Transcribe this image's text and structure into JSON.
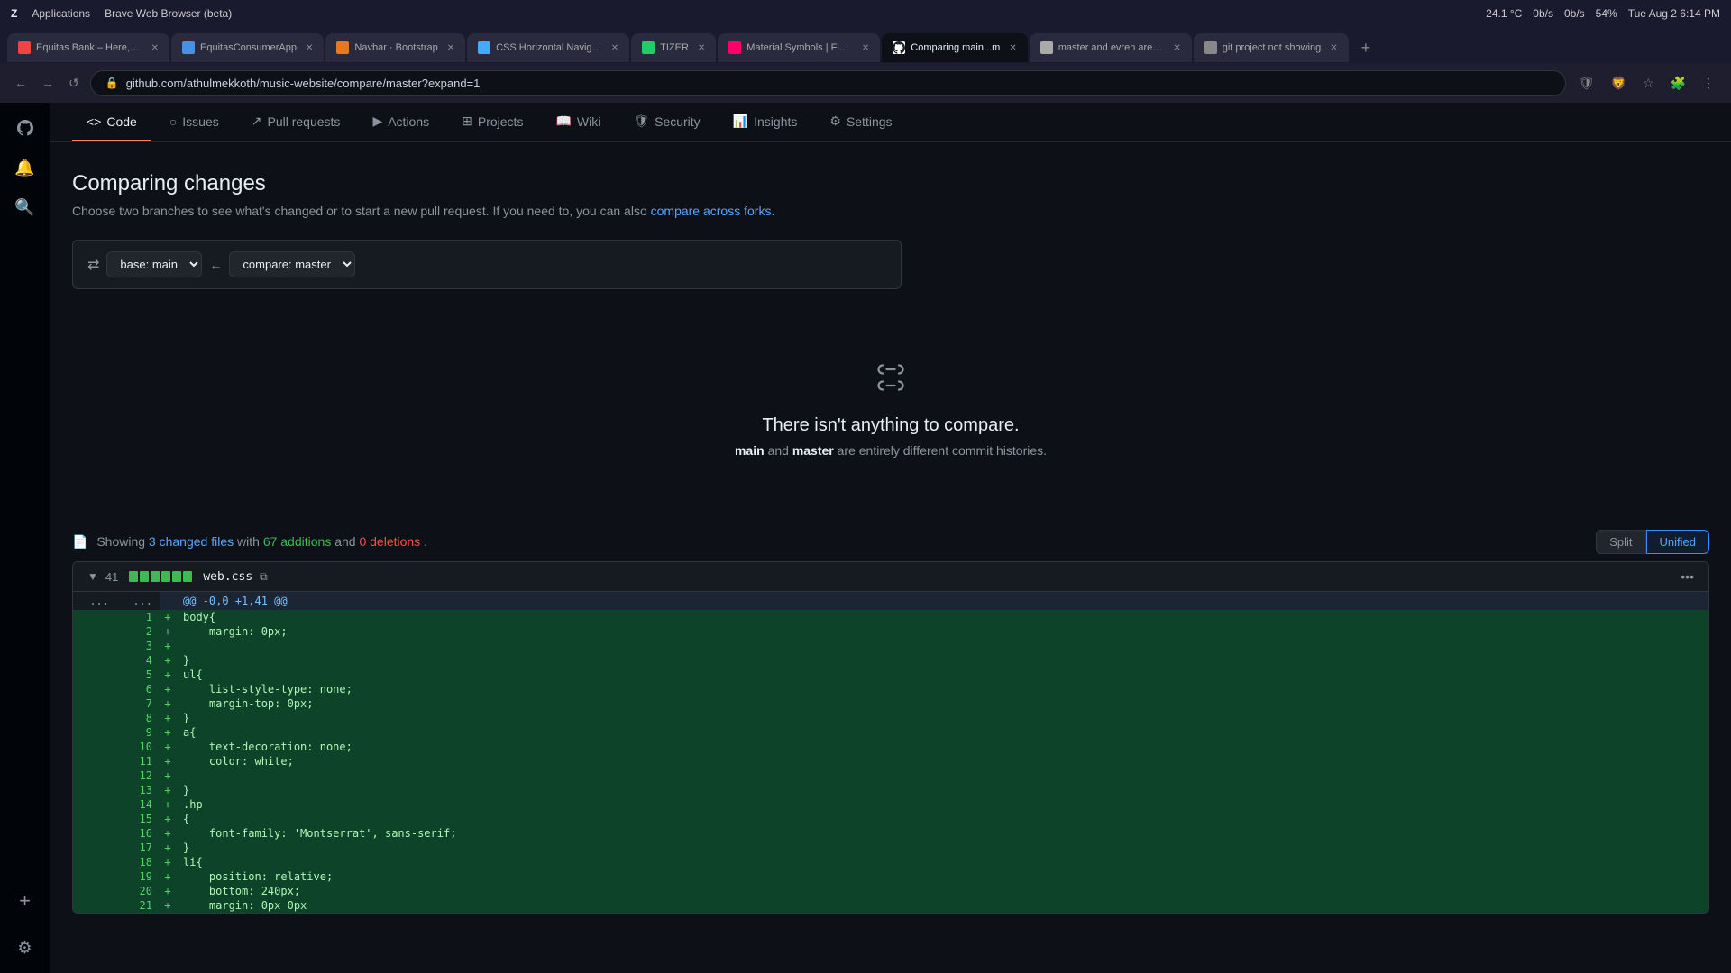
{
  "os": {
    "app_menu": "Applications",
    "browser_name": "Brave Web Browser (beta)",
    "temp": "24.1 °C",
    "network_up": "0b/s",
    "network_down": "0b/s",
    "battery": "54%",
    "datetime": "Tue Aug 2   6:14 PM"
  },
  "tabs": [
    {
      "id": "t1",
      "favicon_color": "#e44",
      "label": "Equitas Bank – Here, yo",
      "active": false
    },
    {
      "id": "t2",
      "favicon_color": "#4a90e2",
      "label": "EquitasConsumerApp",
      "active": false
    },
    {
      "id": "t3",
      "favicon_color": "#e87722",
      "label": "Navbar · Bootstrap",
      "active": false
    },
    {
      "id": "t4",
      "favicon_color": "#44aaff",
      "label": "CSS Horizontal Navigati",
      "active": false
    },
    {
      "id": "t5",
      "favicon_color": "#22cc66",
      "label": "TIZER",
      "active": false
    },
    {
      "id": "t6",
      "favicon_color": "#f06",
      "label": "Material Symbols | Figm",
      "active": false
    },
    {
      "id": "t7",
      "favicon_color": "#fff",
      "label": "Comparing main...m",
      "active": true
    },
    {
      "id": "t8",
      "favicon_color": "#aaa",
      "label": "master and evren are e...",
      "active": false
    },
    {
      "id": "t9",
      "favicon_color": "#888",
      "label": "git project not showing",
      "active": false
    }
  ],
  "address_bar": {
    "url": "github.com/athulmekkoth/music-website/compare/master?expand=1"
  },
  "repo_nav": {
    "items": [
      {
        "id": "code",
        "icon": "<>",
        "label": "Code",
        "active": true
      },
      {
        "id": "issues",
        "icon": "○",
        "label": "Issues",
        "active": false
      },
      {
        "id": "pull-requests",
        "icon": "↗",
        "label": "Pull requests",
        "active": false
      },
      {
        "id": "actions",
        "icon": "▶",
        "label": "Actions",
        "active": false
      },
      {
        "id": "projects",
        "icon": "⊞",
        "label": "Projects",
        "active": false
      },
      {
        "id": "wiki",
        "icon": "📖",
        "label": "Wiki",
        "active": false
      },
      {
        "id": "security",
        "icon": "🛡",
        "label": "Security",
        "active": false
      },
      {
        "id": "insights",
        "icon": "📊",
        "label": "Insights",
        "active": false
      },
      {
        "id": "settings",
        "icon": "⚙",
        "label": "Settings",
        "active": false
      }
    ]
  },
  "page": {
    "title": "Comparing changes",
    "subtitle": "Choose two branches to see what's changed or to start a new pull request. If you need to, you can also",
    "subtitle_link_text": "compare across forks.",
    "subtitle_link_url": "#",
    "base_label": "base: main",
    "compare_label": "compare: master",
    "empty_state": {
      "title": "There isn't anything to compare.",
      "desc_before": "",
      "branch1": "main",
      "between": "and",
      "branch2": "master",
      "desc_after": "are entirely different commit histories."
    },
    "diff_summary": {
      "showing": "Showing",
      "changed_count": "3",
      "changed_label": "changed files",
      "with": "with",
      "additions": "67 additions",
      "and": "and",
      "deletions": "0 deletions",
      "period": "."
    },
    "diff_view": {
      "split_label": "Split",
      "unified_label": "Unified"
    },
    "file": {
      "line_count": "41",
      "name": "web.css",
      "hunk_header": "@@ -0,0 +1,41 @@"
    }
  },
  "code_lines": [
    {
      "old": "",
      "new": "1",
      "sign": "+",
      "code": "body{"
    },
    {
      "old": "",
      "new": "2",
      "sign": "+",
      "code": "    margin: 0px;"
    },
    {
      "old": "",
      "new": "3",
      "sign": "+",
      "code": ""
    },
    {
      "old": "",
      "new": "4",
      "sign": "+",
      "code": "}"
    },
    {
      "old": "",
      "new": "5",
      "sign": "+",
      "code": "ul{"
    },
    {
      "old": "",
      "new": "6",
      "sign": "+",
      "code": "    list-style-type: none;"
    },
    {
      "old": "",
      "new": "7",
      "sign": "+",
      "code": "    margin-top: 0px;"
    },
    {
      "old": "",
      "new": "8",
      "sign": "+",
      "code": "}"
    },
    {
      "old": "",
      "new": "9",
      "sign": "+",
      "code": "a{"
    },
    {
      "old": "",
      "new": "10",
      "sign": "+",
      "code": "    text-decoration: none;"
    },
    {
      "old": "",
      "new": "11",
      "sign": "+",
      "code": "    color: white;"
    },
    {
      "old": "",
      "new": "12",
      "sign": "+",
      "code": ""
    },
    {
      "old": "",
      "new": "13",
      "sign": "+",
      "code": "}"
    },
    {
      "old": "",
      "new": "14",
      "sign": "+",
      "code": ".hp"
    },
    {
      "old": "",
      "new": "15",
      "sign": "+",
      "code": "{"
    },
    {
      "old": "",
      "new": "16",
      "sign": "+",
      "code": "    font-family: 'Montserrat', sans-serif;"
    },
    {
      "old": "",
      "new": "17",
      "sign": "+",
      "code": "}"
    },
    {
      "old": "",
      "new": "18",
      "sign": "+",
      "code": "li{"
    },
    {
      "old": "",
      "new": "19",
      "sign": "+",
      "code": "    position: relative;"
    },
    {
      "old": "",
      "new": "20",
      "sign": "+",
      "code": "    bottom: 240px;"
    },
    {
      "old": "",
      "new": "21",
      "sign": "+",
      "code": "    margin: 0px 0px"
    }
  ],
  "colors": {
    "added_bg": "#0d4429",
    "added_text": "#aff5b4",
    "added_sign": "#3fb950",
    "hunk_bg": "#1c2533",
    "hunk_text": "#8b949e"
  }
}
